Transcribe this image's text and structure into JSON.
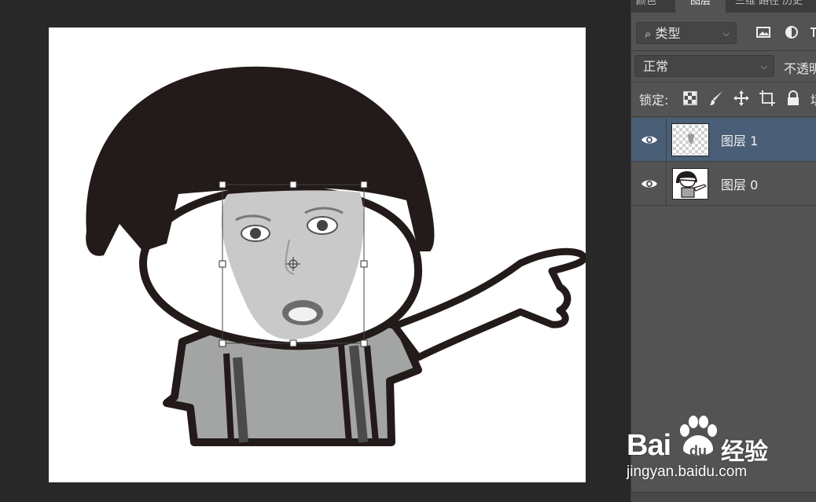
{
  "panel": {
    "tabs": [
      {
        "label": "颜色",
        "active": false
      },
      {
        "label": "图层",
        "active": true
      },
      {
        "label": "三维 路径 历史",
        "active": false
      }
    ],
    "filter": {
      "label": "类型",
      "icons": [
        "image-filter-icon",
        "adjustment-filter-icon",
        "type-filter-icon"
      ]
    },
    "blend_mode": "正常",
    "opacity_label": "不透明",
    "lock_label": "锁定:",
    "lock_icons": [
      "lock-transparent-icon",
      "lock-paint-icon",
      "lock-move-icon",
      "lock-artboard-icon",
      "lock-all-icon"
    ],
    "fill_label": "填",
    "layers": [
      {
        "name": "图层 1",
        "selected": true
      },
      {
        "name": "图层 0",
        "selected": false
      }
    ]
  },
  "watermark": {
    "brand_left": "Bai",
    "brand_mid": "du",
    "brand_cn": "经验",
    "url": "jingyan.baidu.com"
  },
  "colors": {
    "workspace": "#282828",
    "panel": "#535353",
    "selected_layer": "#4a5e77",
    "hair": "#231a1a",
    "shirt": "#a3a5a4"
  }
}
